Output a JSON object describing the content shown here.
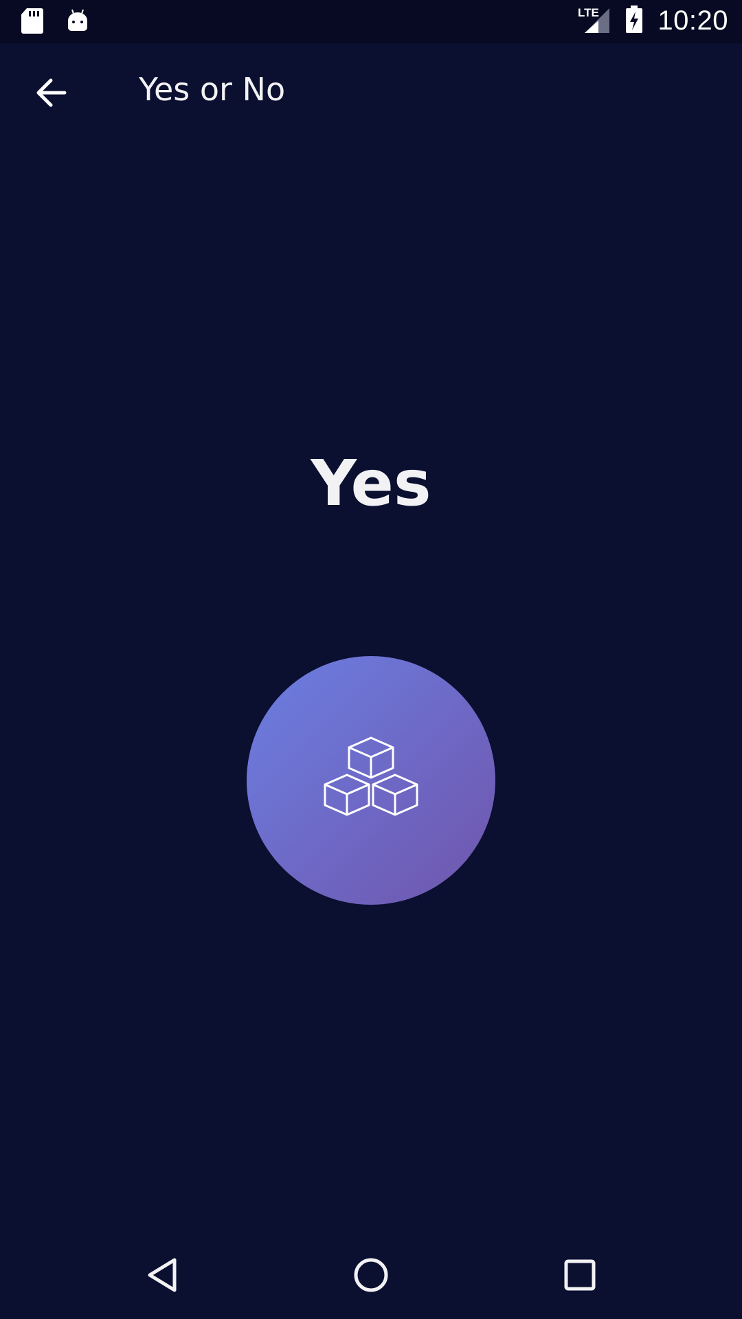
{
  "status_bar": {
    "time": "10:20",
    "network": "LTE",
    "icons": [
      "sd-card-icon",
      "android-icon",
      "lte-signal-icon",
      "battery-charging-icon"
    ]
  },
  "app_bar": {
    "title": "Yes or No",
    "back_icon": "arrow-back-icon"
  },
  "main": {
    "answer": "Yes",
    "button_icon": "stacked-cubes-icon",
    "button_gradient": [
      "#6b7fe2",
      "#7055ac"
    ]
  },
  "nav_bar": {
    "icons": [
      "back-triangle-icon",
      "home-circle-icon",
      "recents-square-icon"
    ]
  },
  "colors": {
    "background": "#0b0f30",
    "status_bar": "#070a22",
    "text": "#f2f2f4"
  }
}
